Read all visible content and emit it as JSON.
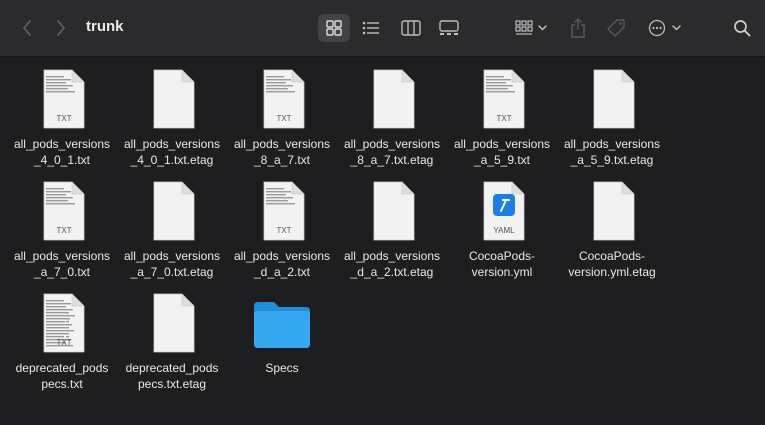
{
  "window": {
    "title": "trunk"
  },
  "toolbar": {
    "back": "chevron-left-icon",
    "forward": "chevron-right-icon",
    "views": [
      "icon-view",
      "list-view",
      "column-view",
      "gallery-view"
    ],
    "selected_view": "icon-view",
    "group": "group-by-icon",
    "share": "share-icon",
    "tags": "tag-icon",
    "more": "ellipsis-icon",
    "search": "search-icon"
  },
  "files": [
    {
      "name": "all_pods_versions\n_4_0_1.txt",
      "kind": "txt",
      "badge": "TXT"
    },
    {
      "name": "all_pods_versions\n_4_0_1.txt.etag",
      "kind": "blank",
      "badge": ""
    },
    {
      "name": "all_pods_versions\n_8_a_7.txt",
      "kind": "txt",
      "badge": "TXT"
    },
    {
      "name": "all_pods_versions\n_8_a_7.txt.etag",
      "kind": "blank",
      "badge": ""
    },
    {
      "name": "all_pods_versions\n_a_5_9.txt",
      "kind": "txt",
      "badge": "TXT"
    },
    {
      "name": "all_pods_versions\n_a_5_9.txt.etag",
      "kind": "blank",
      "badge": ""
    },
    {
      "name": "all_pods_versions\n_a_7_0.txt",
      "kind": "txt",
      "badge": "TXT"
    },
    {
      "name": "all_pods_versions\n_a_7_0.txt.etag",
      "kind": "blank",
      "badge": ""
    },
    {
      "name": "all_pods_versions\n_d_a_2.txt",
      "kind": "txt",
      "badge": "TXT"
    },
    {
      "name": "all_pods_versions\n_d_a_2.txt.etag",
      "kind": "blank",
      "badge": ""
    },
    {
      "name": "CocoaPods-\nversion.yml",
      "kind": "yaml",
      "badge": "YAML"
    },
    {
      "name": "CocoaPods-\nversion.yml.etag",
      "kind": "blank",
      "badge": ""
    },
    {
      "name": "deprecated_pods\npecs.txt",
      "kind": "txt-long",
      "badge": "TXT"
    },
    {
      "name": "deprecated_pods\npecs.txt.etag",
      "kind": "blank",
      "badge": ""
    },
    {
      "name": "Specs",
      "kind": "folder",
      "badge": ""
    }
  ],
  "colors": {
    "folder": "#36a7f1",
    "yaml_accent": "#1a7fe8"
  }
}
